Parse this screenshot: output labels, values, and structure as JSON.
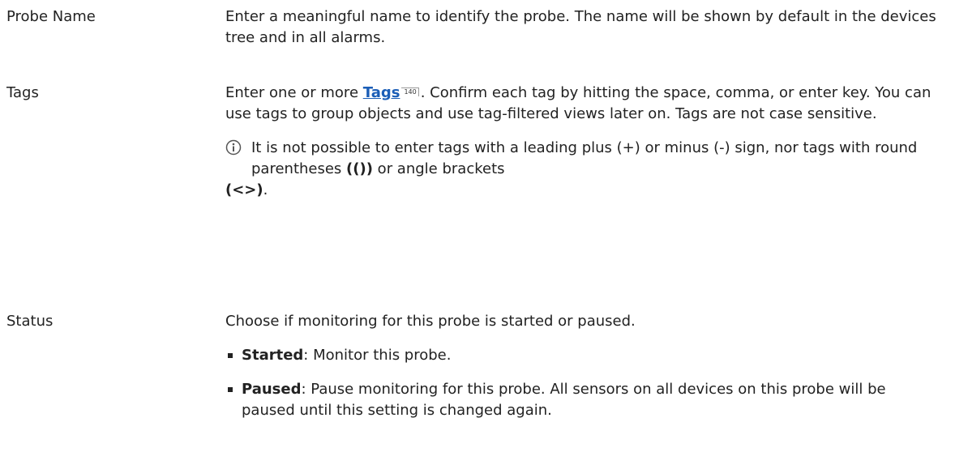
{
  "rows": {
    "probe_name": {
      "term": "Probe Name",
      "desc": "Enter a meaningful name to identify the probe. The name will be shown by default in the devices tree and in all alarms."
    },
    "tags": {
      "term": "Tags",
      "desc_before": "Enter one or more ",
      "link_label": "Tags",
      "link_page": "140",
      "desc_after": ". Confirm each tag by hitting the space, comma, or enter key. You can use tags to group objects and use tag-filtered views later on. Tags are not case sensitive.",
      "note": {
        "text_before": "It is not possible to enter tags with a leading plus ",
        "plus_symbol": "(+)",
        "text_mid1": " or minus (-) sign, nor tags with round parentheses ",
        "parens_symbol": "(())",
        "text_mid2": " or angle brackets",
        "angle_symbol": "(<>)",
        "text_end": "."
      }
    },
    "status": {
      "term": "Status",
      "desc": "Choose if monitoring for this probe is started or paused.",
      "options": [
        {
          "label": "Started",
          "text": ": Monitor this probe."
        },
        {
          "label": "Paused",
          "text": ": Pause monitoring for this probe. All sensors on all devices on this probe will be paused until this setting is changed again."
        }
      ]
    }
  },
  "icons": {
    "info": "info-circle-icon"
  },
  "colors": {
    "link": "#1b5eb7",
    "text": "#222222"
  }
}
